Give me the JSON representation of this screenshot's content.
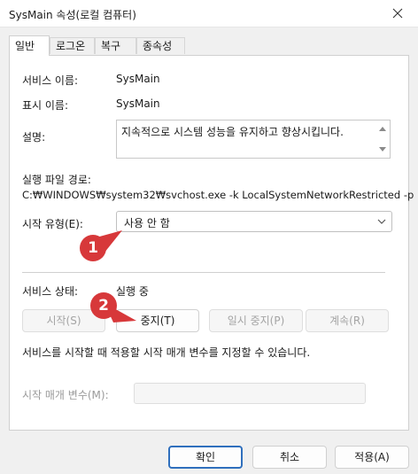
{
  "window": {
    "title": "SysMain 속성(로컬 컴퓨터)"
  },
  "tabs": [
    {
      "label": "일반",
      "active": true
    },
    {
      "label": "로그온"
    },
    {
      "label": "복구"
    },
    {
      "label": "종속성"
    }
  ],
  "general": {
    "service_name_label": "서비스 이름:",
    "service_name_value": "SysMain",
    "display_name_label": "표시 이름:",
    "display_name_value": "SysMain",
    "description_label": "설명:",
    "description_value": "지속적으로 시스템 성능을 유지하고 향상시킵니다.",
    "exe_path_label": "실행 파일 경로:",
    "exe_path_value": "C:₩WINDOWS₩system32₩svchost.exe -k LocalSystemNetworkRestricted -p",
    "startup_type_label": "시작 유형(E):",
    "startup_type_value": "사용 안 함",
    "status_label": "서비스 상태:",
    "status_value": "실행 중"
  },
  "service_buttons": {
    "start": "시작(S)",
    "stop": "중지(T)",
    "pause": "일시 중지(P)",
    "resume": "계속(R)"
  },
  "hint_text": "서비스를 시작할 때 적용할 시작 매개 변수를 지정할 수 있습니다.",
  "start_params": {
    "label": "시작 매개 변수(M):",
    "value": ""
  },
  "dialog_buttons": {
    "ok": "확인",
    "cancel": "취소",
    "apply": "적용(A)"
  },
  "annotations": {
    "badge1": "1",
    "badge2": "2"
  },
  "colors": {
    "badge": "#d7383a",
    "primary_border": "#2f6fbd"
  },
  "icons": {
    "close": "close-icon",
    "combo_arrow": "chevron-down-icon"
  }
}
